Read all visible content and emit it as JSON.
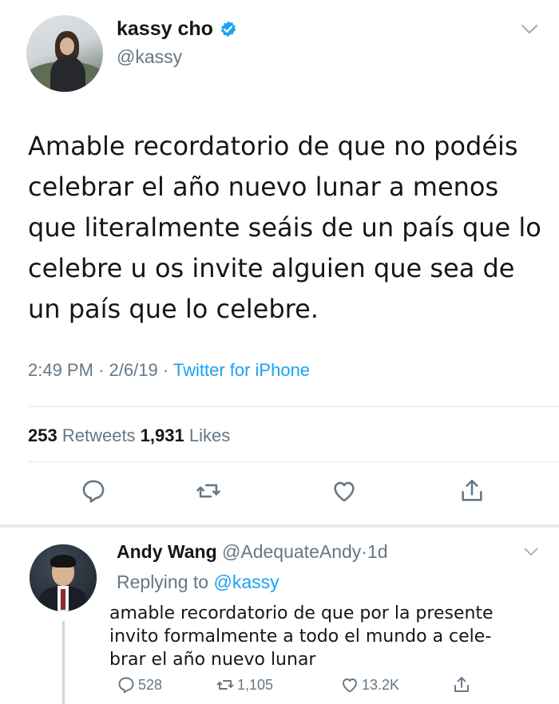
{
  "tweet": {
    "display_name": "kassy cho",
    "handle": "@kassy",
    "text": "Amable recordatorio de que no podéis\ncelebrar el año nuevo lunar a menos\nque literalmente seáis de un país que lo\ncelebre u os invite alguien que sea de\nun país que lo celebre.",
    "time": "2:49 PM",
    "date": "2/6/19",
    "source": "Twitter for iPhone",
    "retweets_count": "253",
    "retweets_label": "Retweets",
    "likes_count": "1,931",
    "likes_label": "Likes",
    "meta_sep": "·",
    "icons": [
      "reply-icon",
      "retweet-icon",
      "like-icon",
      "share-icon"
    ]
  },
  "reply": {
    "display_name": "Andy Wang",
    "handle": "@AdequateAndy",
    "age": "1d",
    "sep": "·",
    "replying_label": "Replying to",
    "replying_to": "@kassy",
    "text": "amable recordatorio de que por la presente\ninvito formalmente a todo el mundo a cele-\nbrar el año nuevo lunar",
    "reply_count": "528",
    "retweet_count": "1,105",
    "like_count": "13.2K"
  },
  "colors": {
    "accent": "#1da1f2",
    "secondary_text": "#657786",
    "primary_text": "#14171a",
    "divider": "#e1e8ed"
  }
}
